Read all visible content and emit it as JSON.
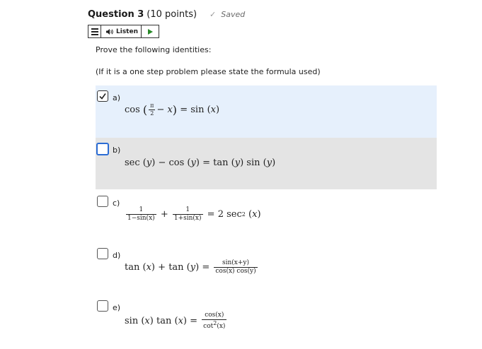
{
  "question": {
    "title": "Question 3",
    "points": "(10 points)",
    "saved_label": "Saved"
  },
  "toolbar": {
    "listen_label": "Listen",
    "icons": [
      "menu-icon",
      "speaker-icon",
      "play-icon"
    ]
  },
  "prompt": {
    "line1": "Prove the following identities:",
    "line2": "(If it is a one step problem please state the formula used)"
  },
  "options": [
    {
      "letter": "a)",
      "checked": true
    },
    {
      "letter": "b)",
      "checked": false,
      "focused": true
    },
    {
      "letter": "c)",
      "checked": false
    },
    {
      "letter": "d)",
      "checked": false
    },
    {
      "letter": "e)",
      "checked": false
    }
  ],
  "math": {
    "a": {
      "func": "cos",
      "pi": "π",
      "two": "2",
      "minus_x": " − x",
      "eq": "=",
      "rhs_func": "sin",
      "x": "x"
    },
    "b": {
      "t1": "sec",
      "y": "y",
      "minus": "−",
      "t2": "cos",
      "eq": "=",
      "t3": "tan",
      "t4": "sin"
    },
    "c": {
      "one": "1",
      "den1": "1−sin(x)",
      "plus": "+",
      "den2": "1+sin(x)",
      "eq": "=",
      "rhs": "2 sec",
      "exp": "2",
      "x": "x"
    },
    "d": {
      "t1": "tan",
      "x": "x",
      "plus": "+",
      "t2": "tan",
      "y": "y",
      "eq": "=",
      "num": "sin(x+y)",
      "den": "cos(x) cos(y)"
    },
    "e": {
      "t1": "sin",
      "x": "x",
      "t2": "tan",
      "eq": "=",
      "num": "cos(x)",
      "den_func": "cot",
      "den_exp": "2",
      "den_arg": "(x)"
    }
  },
  "colors": {
    "selected_bg": "#e6f0fc",
    "focused_bg": "#e4e4e4",
    "focus_border": "#2b6cd4"
  }
}
